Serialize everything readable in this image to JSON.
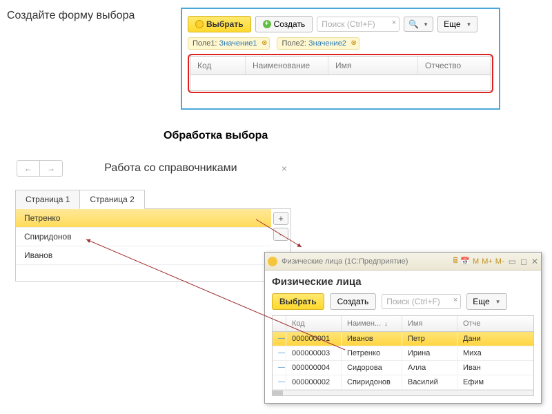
{
  "labels": {
    "create_form": "Создайте форму выбора",
    "process_choice": "Обработка выбора"
  },
  "win1": {
    "select_btn": "Выбрать",
    "create_btn": "Создать",
    "search_placeholder": "Поиск (Ctrl+F)",
    "more_btn": "Еще",
    "filters": [
      {
        "field": "Поле1:",
        "value": "Значение1"
      },
      {
        "field": "Поле2:",
        "value": "Значение2"
      }
    ],
    "columns": {
      "kod": "Код",
      "naim": "Наименование",
      "imya": "Имя",
      "otch": "Отчество"
    }
  },
  "win2": {
    "title": "Работа со справочниками",
    "tab1": "Страница 1",
    "tab2": "Страница 2",
    "items": {
      "i0": "Петренко",
      "i1": "Спиридонов",
      "i2": "Иванов"
    },
    "add": "+",
    "remove": "-"
  },
  "win3": {
    "titlebar": "Физические лица  (1С:Предприятие)",
    "heading": "Физические лица",
    "select_btn": "Выбрать",
    "create_btn": "Создать",
    "search_placeholder": "Поиск (Ctrl+F)",
    "more_btn": "Еще",
    "columns": {
      "kod": "Код",
      "naim": "Наимен...",
      "imya": "Имя",
      "otch": "Отче"
    },
    "sort_indicator": "↓",
    "sys": {
      "m": "M",
      "mplus": "M+",
      "mminus": "M-"
    },
    "rows": [
      {
        "kod": "000000001",
        "naim": "Иванов",
        "imya": "Петр",
        "otch": "Дани"
      },
      {
        "kod": "000000003",
        "naim": "Петренко",
        "imya": "Ирина",
        "otch": "Миха"
      },
      {
        "kod": "000000004",
        "naim": "Сидорова",
        "imya": "Алла",
        "otch": "Иван"
      },
      {
        "kod": "000000002",
        "naim": "Спиридонов",
        "imya": "Василий",
        "otch": "Ефим"
      }
    ]
  }
}
